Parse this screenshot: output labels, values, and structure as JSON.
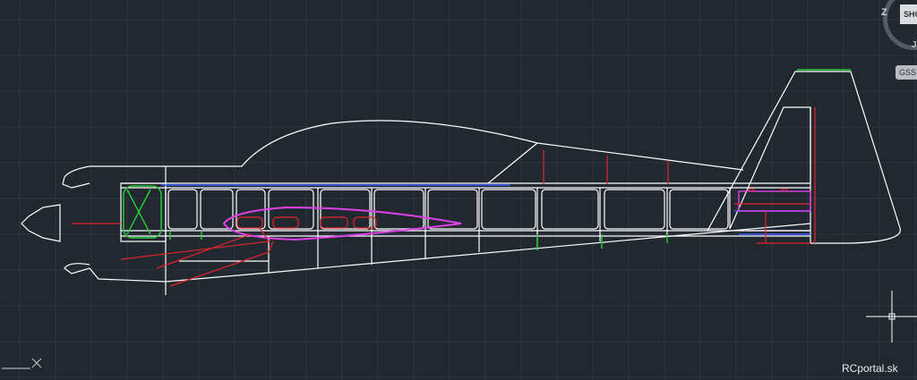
{
  "viewcube": {
    "face_label": "SHO",
    "compass_top_label": "Z",
    "compass_bottom_label": "J",
    "wcs_label": "GSS"
  },
  "watermark": "RCportal.sk",
  "colors": {
    "background": "#212830",
    "grid": "#2c3440",
    "outline": "#ffffff",
    "former_red": "#e0242a",
    "former_green": "#27d13a",
    "wing_magenta": "#e040e8",
    "spar_blue": "#3a5cff"
  }
}
